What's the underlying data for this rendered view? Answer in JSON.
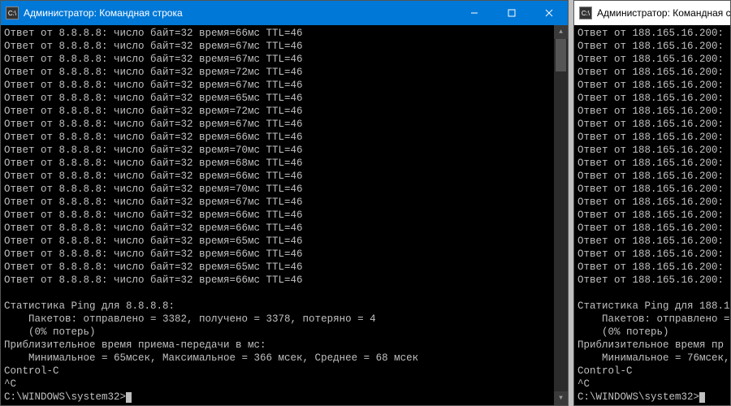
{
  "left": {
    "title": "Администратор: Командная строка",
    "icon_glyph": "C:\\",
    "ping_ip": "8.8.8.8",
    "replies": [
      {
        "bytes": 32,
        "time": 66,
        "ttl": 46
      },
      {
        "bytes": 32,
        "time": 67,
        "ttl": 46
      },
      {
        "bytes": 32,
        "time": 67,
        "ttl": 46
      },
      {
        "bytes": 32,
        "time": 72,
        "ttl": 46
      },
      {
        "bytes": 32,
        "time": 67,
        "ttl": 46
      },
      {
        "bytes": 32,
        "time": 65,
        "ttl": 46
      },
      {
        "bytes": 32,
        "time": 72,
        "ttl": 46
      },
      {
        "bytes": 32,
        "time": 67,
        "ttl": 46
      },
      {
        "bytes": 32,
        "time": 66,
        "ttl": 46
      },
      {
        "bytes": 32,
        "time": 70,
        "ttl": 46
      },
      {
        "bytes": 32,
        "time": 68,
        "ttl": 46
      },
      {
        "bytes": 32,
        "time": 66,
        "ttl": 46
      },
      {
        "bytes": 32,
        "time": 70,
        "ttl": 46
      },
      {
        "bytes": 32,
        "time": 67,
        "ttl": 46
      },
      {
        "bytes": 32,
        "time": 66,
        "ttl": 46
      },
      {
        "bytes": 32,
        "time": 66,
        "ttl": 46
      },
      {
        "bytes": 32,
        "time": 65,
        "ttl": 46
      },
      {
        "bytes": 32,
        "time": 66,
        "ttl": 46
      },
      {
        "bytes": 32,
        "time": 65,
        "ttl": 46
      },
      {
        "bytes": 32,
        "time": 66,
        "ttl": 46
      }
    ],
    "stats": {
      "header": "Статистика Ping для 8.8.8.8:",
      "packets": "    Пакетов: отправлено = 3382, получено = 3378, потеряно = 4",
      "loss": "    (0% потерь)",
      "rtt_header": "Приблизительное время приема-передачи в мс:",
      "rtt": "    Минимальное = 65мсек, Максимальное = 366 мсек, Среднее = 68 мсек"
    },
    "ctrl_c": "Control-C",
    "caret_c": "^C",
    "prompt": "C:\\WINDOWS\\system32>"
  },
  "right": {
    "title": "Администратор: Командная ст",
    "icon_glyph": "C:\\",
    "ping_ip": "188.165.16.200",
    "reply_count": 20,
    "stats": {
      "header": "Статистика Ping для 188.1",
      "packets": "    Пакетов: отправлено =",
      "loss": "    (0% потерь)",
      "rtt_header": "Приблизительное время пр",
      "rtt": "    Минимальное = 76мсек,"
    },
    "ctrl_c": "Control-C",
    "caret_c": "^C",
    "prompt": "C:\\WINDOWS\\system32>"
  }
}
